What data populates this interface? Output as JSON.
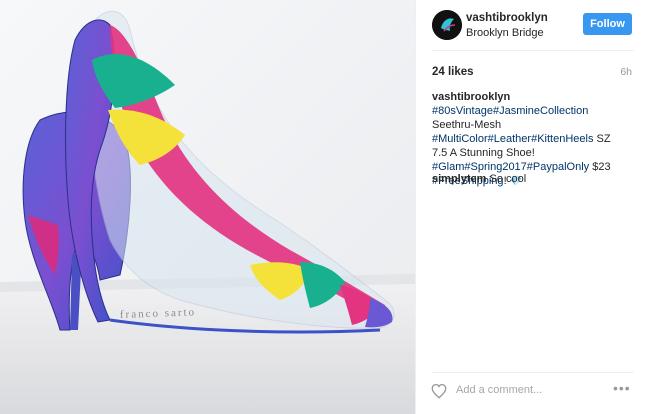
{
  "header": {
    "username": "vashtibrooklyn",
    "location": "Brooklyn Bridge",
    "follow_label": "Follow"
  },
  "stats": {
    "likes": "24 likes",
    "time": "6h"
  },
  "caption": {
    "username": "vashtibrooklyn",
    "parts": [
      {
        "t": "#80sVintage",
        "tag": true
      },
      {
        "t": "#JasmineCollection",
        "tag": true
      },
      {
        "t": " Seethru-Mesh ",
        "tag": false
      },
      {
        "t": "#MultiColor",
        "tag": true
      },
      {
        "t": "#Leather",
        "tag": true
      },
      {
        "t": "#KittenHeels",
        "tag": true
      },
      {
        "t": " SZ 7.5 A Stunning Shoe! ",
        "tag": false
      },
      {
        "t": "#Glam",
        "tag": true
      },
      {
        "t": "#Spring2017",
        "tag": true
      },
      {
        "t": "#PaypalOnly",
        "tag": true
      },
      {
        "t": " $23 ",
        "tag": false
      },
      {
        "t": "#FreeShipping",
        "tag": true
      },
      {
        "t": "!",
        "tag": false
      }
    ],
    "emoji": "💎"
  },
  "comment": {
    "username": "simplytem",
    "text": "So cool"
  },
  "actions": {
    "add_comment_placeholder": "Add a comment...",
    "more": "•••"
  },
  "photo": {
    "box_label": "franco sarto"
  },
  "colors": {
    "follow_blue": "#3897f0",
    "hashtag": "#003569",
    "border": "#efefef"
  }
}
